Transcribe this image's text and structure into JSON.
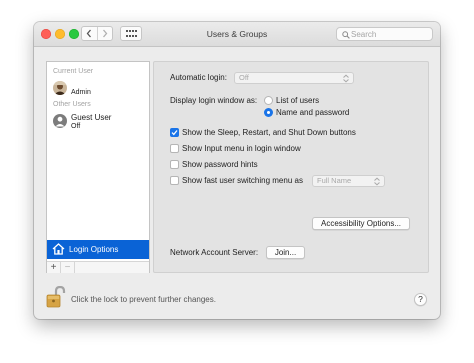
{
  "window": {
    "title": "Users & Groups",
    "search_placeholder": "Search"
  },
  "sidebar": {
    "current_user_header": "Current User",
    "current_user": {
      "name": "Admin"
    },
    "other_users_header": "Other Users",
    "other_users": [
      {
        "name": "Guest User",
        "status": "Off"
      }
    ],
    "login_options_label": "Login Options",
    "add_label": "+",
    "remove_label": "−"
  },
  "panel": {
    "automatic_login_label": "Automatic login:",
    "automatic_login_value": "Off",
    "display_login_label": "Display login window as:",
    "display_options": [
      {
        "label": "List of users",
        "selected": false
      },
      {
        "label": "Name and password",
        "selected": true
      }
    ],
    "checkboxes": [
      {
        "label": "Show the Sleep, Restart, and Shut Down buttons",
        "checked": true
      },
      {
        "label": "Show Input menu in login window",
        "checked": false
      },
      {
        "label": "Show password hints",
        "checked": false
      },
      {
        "label": "Show fast user switching menu as",
        "checked": false
      }
    ],
    "fast_switch_value": "Full Name",
    "accessibility_button": "Accessibility Options...",
    "network_label": "Network Account Server:",
    "join_button": "Join..."
  },
  "footer": {
    "lock_text": "Click the lock to prevent further changes.",
    "help_label": "?"
  },
  "colors": {
    "selection": "#0a63d6",
    "accent": "#1a74e8",
    "window_bg": "#ececec",
    "panel_bg": "#e3e3e3"
  }
}
